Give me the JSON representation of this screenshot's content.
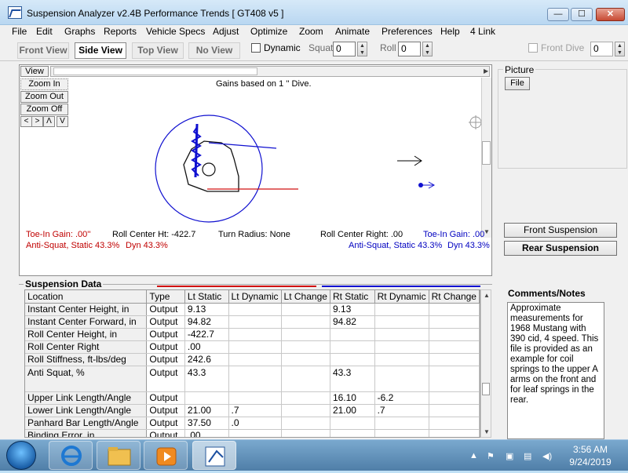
{
  "window": {
    "title": "Suspension Analyzer v2.4B   Performance Trends   [ GT408 v5 ]",
    "minimize": "—",
    "maximize": "☐",
    "close": "✕"
  },
  "menu": [
    "File",
    "Edit",
    "Graphs",
    "Reports",
    "Vehicle Specs",
    "Adjust",
    "Optimize",
    "Zoom",
    "Animate",
    "Preferences",
    "Help",
    "4 Link"
  ],
  "toolbar": {
    "tabs": [
      "Front View",
      "Side View",
      "Top View",
      "No View"
    ],
    "active_tab": "Side View",
    "dynamic_label": "Dynamic",
    "squat_label": "Squat",
    "squat_value": "0",
    "roll_label": "Roll",
    "roll_value": "0",
    "front_dive_label": "Front Dive",
    "front_dive_value": "0"
  },
  "graph": {
    "view_button": "View",
    "zoom_in": "Zoom In",
    "zoom_out": "Zoom Out",
    "zoom_off": "Zoom Off",
    "nav": [
      "<",
      ">",
      "Λ",
      "V"
    ],
    "gains_text": "Gains based on 1 '' Dive.",
    "toe_in_gain_left": "Toe-In Gain: .00''",
    "roll_center_ht": "Roll Center Ht: -422.7",
    "turn_radius": "Turn Radius: None",
    "roll_center_right": "Roll Center Right: .00",
    "toe_in_gain_right": "Toe-In Gain: .00",
    "anti_squat_left": "Anti-Squat, Static 43.3%",
    "dyn_left": "Dyn 43.3%",
    "anti_squat_right": "Anti-Squat, Static 43.3%",
    "dyn_right": "Dyn 43.3%"
  },
  "picture": {
    "label": "Picture",
    "file_button": "File"
  },
  "buttons": {
    "front_suspension": "Front Suspension",
    "rear_suspension": "Rear Suspension"
  },
  "suspension_data": {
    "title": "Suspension Data",
    "columns": [
      "Location",
      "Type",
      "Lt Static",
      "Lt Dynamic",
      "Lt Change",
      "Rt Static",
      "Rt Dynamic",
      "Rt Change"
    ],
    "rows": [
      [
        "Instant Center Height, in",
        "Output",
        "9.13",
        "",
        "",
        "9.13",
        "",
        ""
      ],
      [
        "Instant Center Forward, in",
        "Output",
        "94.82",
        "",
        "",
        "94.82",
        "",
        ""
      ],
      [
        "Roll Center Height, in",
        "Output",
        "-422.7",
        "",
        "",
        "",
        "",
        ""
      ],
      [
        "Roll Center Right",
        "Output",
        ".00",
        "",
        "",
        "",
        "",
        ""
      ],
      [
        "Roll Stiffness, ft-lbs/deg",
        "Output",
        "242.6",
        "",
        "",
        "",
        "",
        ""
      ],
      [
        "Anti Squat, %",
        "Output",
        "43.3",
        "",
        "",
        "43.3",
        "",
        ""
      ],
      [
        "Upper Link Length/Angle",
        "Output",
        "",
        "",
        "",
        "16.10",
        "-6.2",
        ""
      ],
      [
        "Lower Link Length/Angle",
        "Output",
        "21.00",
        ".7",
        "",
        "21.00",
        ".7",
        ""
      ],
      [
        "Panhard Bar Length/Angle",
        "Output",
        "37.50",
        ".0",
        "",
        "",
        "",
        ""
      ],
      [
        "Binding Error, in",
        "Output",
        ".00",
        "",
        "",
        "",
        "",
        ""
      ]
    ]
  },
  "comments": {
    "title": "Comments/Notes",
    "text": "Approximate measurements for 1968 Mustang with 390 cid, 4 speed. This file is provided as an example for coil springs to the upper A arms on the front and for leaf springs in the rear."
  },
  "taskbar": {
    "time": "3:56 AM",
    "date": "9/24/2019"
  },
  "colors": {
    "static_left": "#c00000",
    "static_right": "#0000c0",
    "graph_circle": "#1010d0",
    "graph_line_red": "#d01010"
  }
}
